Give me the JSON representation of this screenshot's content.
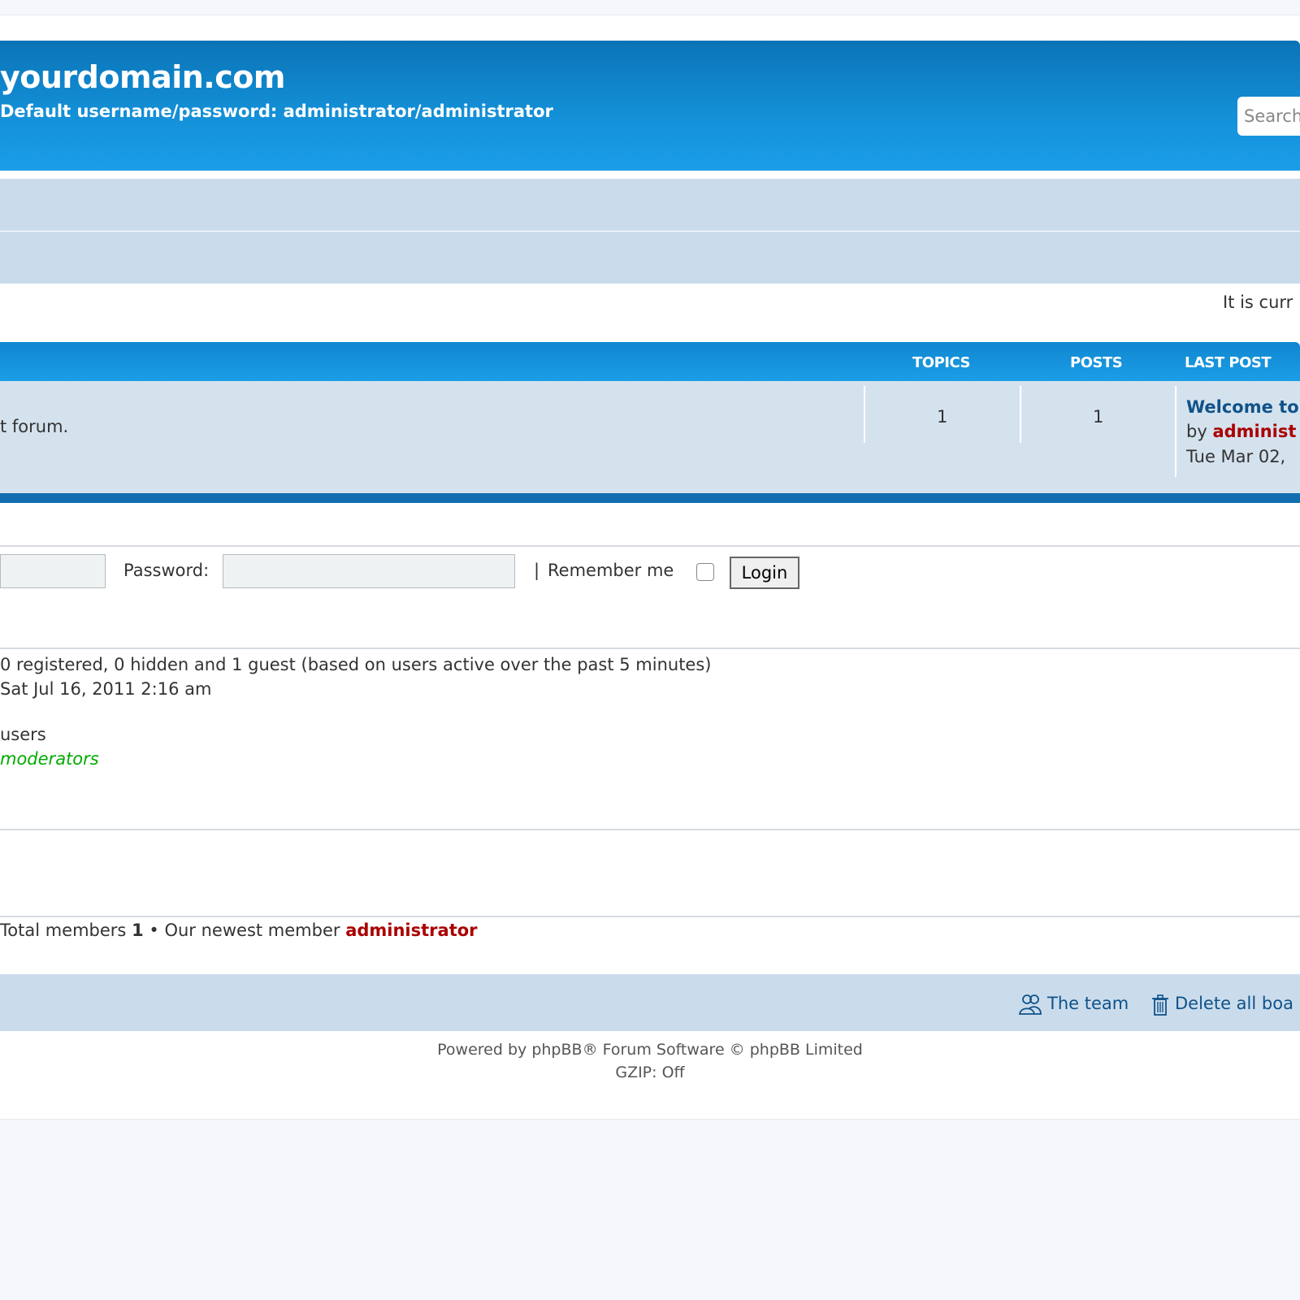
{
  "header": {
    "site_title": "yourdomain.com",
    "site_description": "Default username/password: administrator/administrator",
    "search_placeholder": "Search"
  },
  "time_notice": "It is curr",
  "forum_table": {
    "columns": {
      "topics": "TOPICS",
      "posts": "POSTS",
      "last_post": "LAST POST"
    },
    "rows": [
      {
        "description": "t forum.",
        "topics": "1",
        "posts": "1",
        "last_post_title": "Welcome to",
        "last_post_by_prefix": "by",
        "last_post_author": "administ",
        "last_post_date": "Tue Mar 02,"
      }
    ]
  },
  "login": {
    "password_label": "Password:",
    "separator": "|",
    "remember_label": "Remember me",
    "login_button": "Login"
  },
  "stats": {
    "online_line": "0 registered, 0 hidden and 1 guest (based on users active over the past 5 minutes)",
    "record_line": " Sat Jul 16, 2011 2:16 am",
    "legend_users": "users",
    "legend_moderators": "moderators",
    "total_members_label": "Total members",
    "total_members_value": "1",
    "bullet": "•",
    "newest_member_label": "Our newest member",
    "newest_member_name": "administrator"
  },
  "footer": {
    "the_team": "The team",
    "delete_cookies": "Delete all boa",
    "powered_by_prefix": "Powered by",
    "phpbb_link": "phpBB",
    "powered_by_suffix": "® Forum Software © phpBB Limited",
    "gzip": "GZIP: Off"
  },
  "colors": {
    "header_blue": "#138fd6",
    "nav_bar": "#cadcec",
    "row_bg": "#d4e2ee",
    "row_border": "#106eb0",
    "link_blue": "#105289",
    "admin_red": "#aa0000",
    "moderator_green": "#00aa00"
  }
}
